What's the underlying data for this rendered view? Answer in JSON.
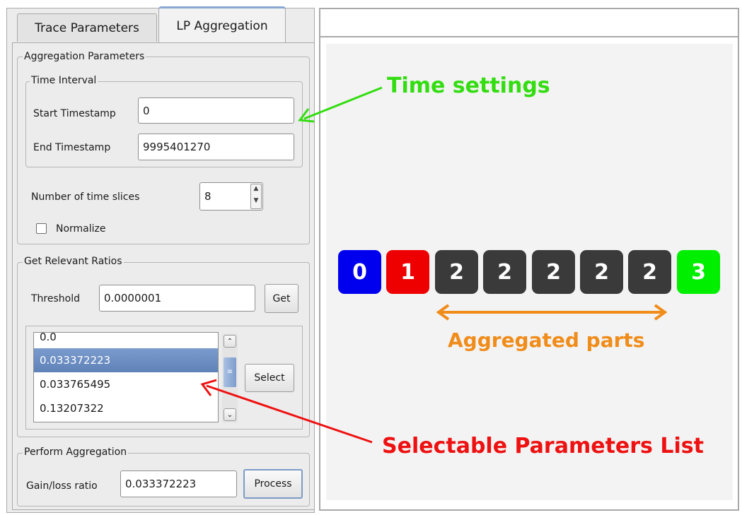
{
  "tabs": [
    {
      "label": "Trace Parameters",
      "active": false
    },
    {
      "label": "LP Aggregation",
      "active": true
    }
  ],
  "aggregation_parameters": {
    "legend": "Aggregation Parameters",
    "time_interval": {
      "legend": "Time Interval",
      "start_label": "Start Timestamp",
      "start_value": "0",
      "end_label": "End Timestamp",
      "end_value": "9995401270"
    },
    "time_slices_label": "Number of time slices",
    "time_slices_value": "8",
    "normalize_label": "Normalize",
    "normalize_checked": false
  },
  "relevant_ratios": {
    "legend": "Get Relevant Ratios",
    "threshold_label": "Threshold",
    "threshold_value": "0.0000001",
    "get_label": "Get",
    "select_label": "Select",
    "ratios": [
      "0.0",
      "0.033372223",
      "0.033765495",
      "0.13207322"
    ],
    "selected_index": 1
  },
  "perform_aggregation": {
    "legend": "Perform Aggregation",
    "ratio_label": "Gain/loss ratio",
    "ratio_value": "0.033372223",
    "process_label": "Process"
  },
  "slices": [
    {
      "value": "0",
      "color": "#0000ee"
    },
    {
      "value": "1",
      "color": "#ee0000"
    },
    {
      "value": "2",
      "color": "#3a3a3a"
    },
    {
      "value": "2",
      "color": "#3a3a3a"
    },
    {
      "value": "2",
      "color": "#3a3a3a"
    },
    {
      "value": "2",
      "color": "#3a3a3a"
    },
    {
      "value": "2",
      "color": "#3a3a3a"
    },
    {
      "value": "3",
      "color": "#00ee00"
    }
  ],
  "annotations": {
    "time_settings": "Time settings",
    "time_settings_color": "#33dd11",
    "aggregated_parts": "Aggregated parts",
    "aggregated_parts_color": "#f08c1a",
    "selectable_list": "Selectable Parameters List",
    "selectable_list_color": "#ee1111"
  }
}
